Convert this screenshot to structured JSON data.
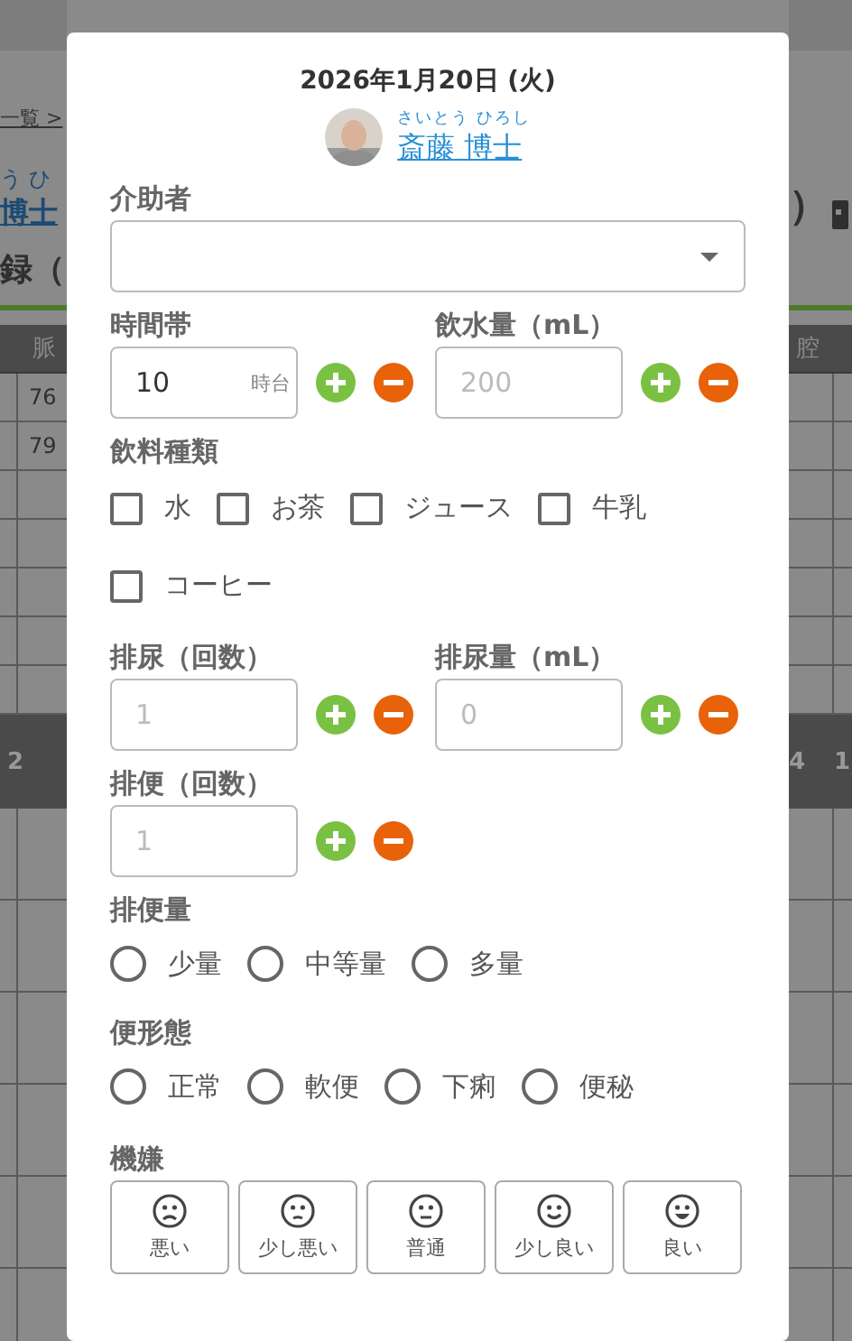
{
  "background": {
    "left": {
      "breadcrumb": "一覧 >",
      "ruby": "う ひ",
      "name": "博士",
      "heading": "録（",
      "header_cell": "脈",
      "cells": [
        "76",
        "79"
      ],
      "band_cell": "2"
    },
    "right": {
      "heading": "）",
      "header_cell": "腔",
      "band_cells": [
        "4",
        "1"
      ]
    }
  },
  "modal": {
    "date": "2026年1月20日 (火)",
    "patient": {
      "ruby": "さいとう ひろし",
      "name": "斎藤 博士"
    },
    "sections": [
      {
        "kind": "select",
        "label": "介助者"
      },
      {
        "kind": "steppers",
        "fields": [
          {
            "label": "時間帯",
            "value": "10",
            "suffix": "時台"
          },
          {
            "label": "飲水量（mL）",
            "placeholder": "200"
          }
        ]
      },
      {
        "kind": "checkboxes",
        "label": "飲料種類",
        "options": [
          {
            "label": "水",
            "checked": false
          },
          {
            "label": "お茶",
            "checked": false
          },
          {
            "label": "ジュース",
            "checked": false
          },
          {
            "label": "牛乳",
            "checked": false
          },
          {
            "label": "コーヒー",
            "checked": false
          }
        ]
      },
      {
        "kind": "steppers",
        "fields": [
          {
            "label": "排尿（回数）",
            "placeholder": "1"
          },
          {
            "label": "排尿量（mL）",
            "placeholder": "0"
          }
        ]
      },
      {
        "kind": "steppers",
        "fields": [
          {
            "label": "排便（回数）",
            "placeholder": "1"
          }
        ]
      },
      {
        "kind": "radios",
        "label": "排便量",
        "options": [
          {
            "label": "少量",
            "selected": false
          },
          {
            "label": "中等量",
            "selected": false
          },
          {
            "label": "多量",
            "selected": false
          }
        ]
      },
      {
        "kind": "radios",
        "label": "便形態",
        "options": [
          {
            "label": "正常",
            "selected": false
          },
          {
            "label": "軟便",
            "selected": false
          },
          {
            "label": "下痢",
            "selected": false
          },
          {
            "label": "便秘",
            "selected": false
          }
        ]
      },
      {
        "kind": "moods",
        "label": "機嫌",
        "options": [
          {
            "label": "悪い",
            "selected": false
          },
          {
            "label": "少し悪い",
            "selected": false
          },
          {
            "label": "普通",
            "selected": false
          },
          {
            "label": "少し良い",
            "selected": false
          },
          {
            "label": "良い",
            "selected": false
          }
        ]
      }
    ]
  }
}
